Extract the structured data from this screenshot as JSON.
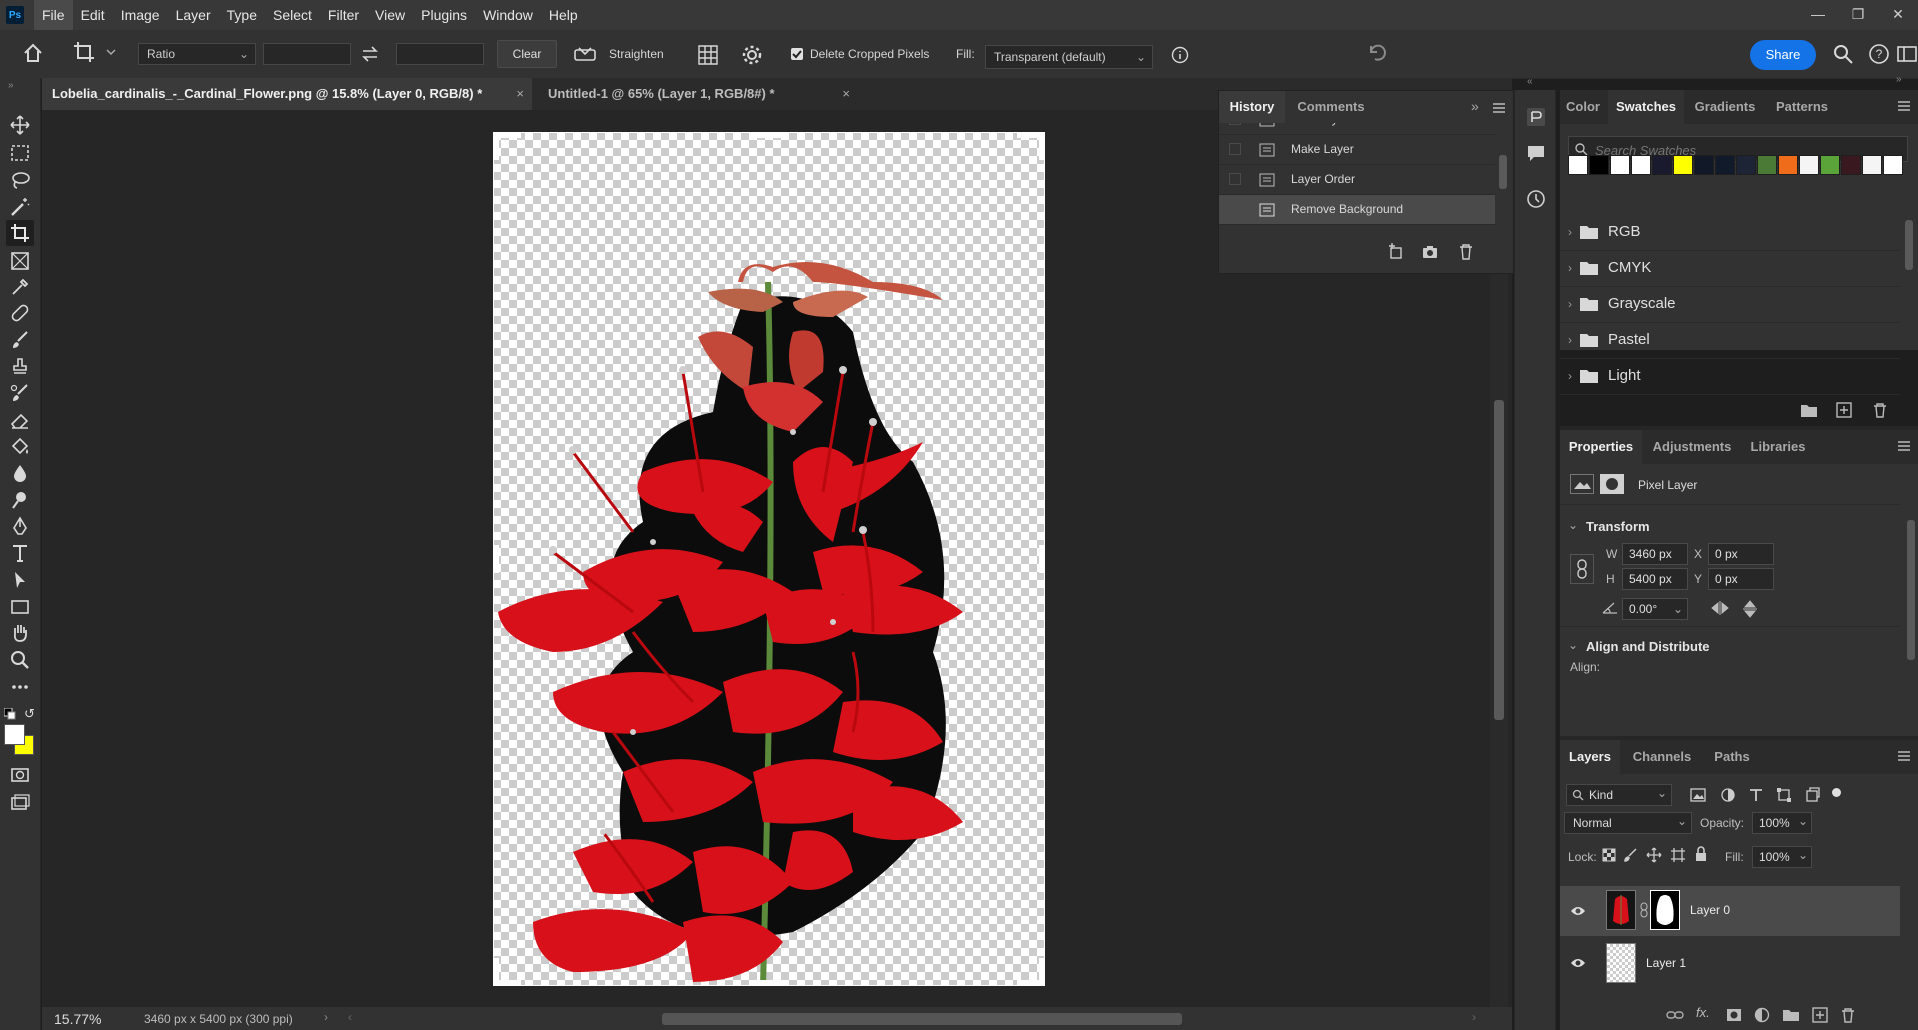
{
  "app": {
    "logo": "Ps"
  },
  "menu": [
    "File",
    "Edit",
    "Image",
    "Layer",
    "Type",
    "Select",
    "Filter",
    "View",
    "Plugins",
    "Window",
    "Help"
  ],
  "options": {
    "ratio_label": "Ratio",
    "clear_label": "Clear",
    "straighten_label": "Straighten",
    "delete_cropped_label": "Delete Cropped Pixels",
    "fill_label": "Fill:",
    "fill_value": "Transparent (default)",
    "share_label": "Share"
  },
  "tabs": [
    {
      "label": "Lobelia_cardinalis_-_Cardinal_Flower.png @ 15.8% (Layer 0, RGB/8) *"
    },
    {
      "label": "Untitled-1 @ 65% (Layer 1, RGB/8#) *"
    }
  ],
  "status": {
    "zoom": "15.77%",
    "doc_info": "3460 px x 5400 px (300 ppi)"
  },
  "history": {
    "tabs": [
      "History",
      "Comments"
    ],
    "items": [
      "New Layer",
      "Make Layer",
      "Layer Order",
      "Remove Background"
    ]
  },
  "swatches": {
    "tabs": [
      "Color",
      "Swatches",
      "Gradients",
      "Patterns"
    ],
    "search_placeholder": "Search Swatches",
    "colors": [
      "#ffffff",
      "#000000",
      "#ffffff",
      "#ffffff",
      "#1a1a2e",
      "#ffff00",
      "#111827",
      "#101a2a",
      "#1c2436",
      "#4a7a35",
      "#ef6c1a",
      "#f5f5f5",
      "#5aa43a",
      "#3a1820",
      "#f5f5f5",
      "#ffffff"
    ],
    "folders": [
      "RGB",
      "CMYK",
      "Grayscale",
      "Pastel",
      "Light"
    ]
  },
  "properties": {
    "tabs": [
      "Properties",
      "Adjustments",
      "Libraries"
    ],
    "layer_type": "Pixel Layer",
    "transform_title": "Transform",
    "w_label": "W",
    "w_value": "3460 px",
    "h_label": "H",
    "h_value": "5400 px",
    "x_label": "X",
    "x_value": "0 px",
    "y_label": "Y",
    "y_value": "0 px",
    "angle_value": "0.00°",
    "align_title": "Align and Distribute",
    "align_label": "Align:"
  },
  "layers": {
    "tabs": [
      "Layers",
      "Channels",
      "Paths"
    ],
    "kind_label": "Kind",
    "blend_mode": "Normal",
    "opacity_label": "Opacity:",
    "opacity_value": "100%",
    "lock_label": "Lock:",
    "fill_label": "Fill:",
    "fill_value": "100%",
    "items": [
      {
        "name": "Layer 0"
      },
      {
        "name": "Layer 1"
      }
    ]
  },
  "colors": {
    "accent": "#1473e6",
    "flower_red": "#d81019"
  }
}
